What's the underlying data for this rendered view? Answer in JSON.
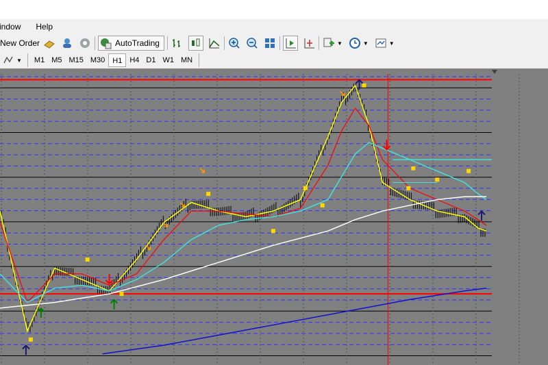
{
  "menu": {
    "items": [
      "indow",
      "Help"
    ]
  },
  "toolbar": {
    "new_order_label": "New Order",
    "autotrading_label": "AutoTrading"
  },
  "timeframes": {
    "items": [
      "M1",
      "M5",
      "M15",
      "M30",
      "H1",
      "H4",
      "D1",
      "W1",
      "MN"
    ],
    "active": "H1"
  },
  "colors": {
    "chart_bg": "#808080",
    "candles": "#000000",
    "ma_fast": "#ffff00",
    "ma_mid": "#ff0000",
    "ma_cyan": "#40e0e0",
    "ma_slow": "#ffffff",
    "ma_long": "#1010d0",
    "level_line": "#ff0000",
    "grid_solid": "#000000",
    "grid_dash": "#3030ff",
    "marker_square": "#ffd700",
    "arrow_orange": "#ff9900",
    "arrow_up_green": "#008000",
    "arrow_up_navy": "#1a1a6e",
    "arrow_down_red": "#ff0000"
  },
  "icons": [
    "chevron-down-icon",
    "new-order-icon",
    "gold-bars-icon",
    "people-icon",
    "signal-icon",
    "autotrading-icon",
    "bar-chart-icon",
    "candle-chart-icon",
    "line-chart-icon",
    "zoom-in-icon",
    "zoom-out-icon",
    "tile-windows-icon",
    "autoscroll-icon",
    "chart-shift-icon",
    "indicators-icon",
    "clock-icon",
    "templates-icon"
  ],
  "chart_data": {
    "type": "line",
    "series": [
      {
        "id": "price",
        "x": [
          0,
          40,
          80,
          120,
          160,
          200,
          240,
          280,
          320,
          360,
          400,
          440,
          480,
          500,
          520,
          540,
          560,
          600,
          640,
          680,
          700,
          712
        ],
        "y": [
          0.52,
          0.1,
          0.32,
          0.28,
          0.24,
          0.35,
          0.48,
          0.55,
          0.52,
          0.5,
          0.52,
          0.56,
          0.78,
          0.9,
          0.96,
          0.82,
          0.62,
          0.56,
          0.52,
          0.5,
          0.46,
          0.45
        ]
      },
      {
        "id": "ma_mid",
        "x": [
          0,
          40,
          80,
          120,
          160,
          200,
          240,
          280,
          320,
          360,
          400,
          440,
          480,
          500,
          520,
          540,
          560,
          600,
          640,
          680,
          700,
          712
        ],
        "y": [
          0.48,
          0.2,
          0.3,
          0.3,
          0.26,
          0.3,
          0.42,
          0.52,
          0.52,
          0.51,
          0.5,
          0.53,
          0.68,
          0.8,
          0.88,
          0.82,
          0.7,
          0.6,
          0.56,
          0.52,
          0.49,
          0.47
        ]
      },
      {
        "id": "ma_cyan",
        "x": [
          0,
          40,
          80,
          120,
          160,
          200,
          240,
          280,
          320,
          360,
          400,
          440,
          480,
          500,
          520,
          540,
          560,
          600,
          640,
          680,
          700,
          712
        ],
        "y": [
          0.3,
          0.2,
          0.25,
          0.26,
          0.24,
          0.28,
          0.34,
          0.42,
          0.47,
          0.49,
          0.5,
          0.52,
          0.56,
          0.64,
          0.72,
          0.76,
          0.74,
          0.7,
          0.66,
          0.62,
          0.58,
          0.56
        ]
      },
      {
        "id": "ma_slow",
        "x": [
          0,
          80,
          160,
          240,
          320,
          400,
          480,
          520,
          560,
          600,
          640,
          680,
          712
        ],
        "y": [
          0.18,
          0.2,
          0.23,
          0.28,
          0.34,
          0.4,
          0.45,
          0.49,
          0.52,
          0.54,
          0.56,
          0.57,
          0.57
        ]
      },
      {
        "id": "ma_long",
        "x": [
          150,
          240,
          330,
          420,
          510,
          600,
          680,
          712
        ],
        "y": [
          0.02,
          0.05,
          0.09,
          0.13,
          0.17,
          0.21,
          0.24,
          0.25
        ]
      }
    ],
    "levels": [
      0.98,
      0.23
    ],
    "vline_x": 568,
    "xlim": [
      0,
      720
    ],
    "ylim": [
      0,
      1
    ],
    "squares": [
      [
        45,
        0.07
      ],
      [
        128,
        0.35
      ],
      [
        178,
        0.23
      ],
      [
        305,
        0.58
      ],
      [
        400,
        0.45
      ],
      [
        447,
        0.6
      ],
      [
        472,
        0.54
      ],
      [
        533,
        0.96
      ],
      [
        598,
        0.6
      ],
      [
        605,
        0.67
      ],
      [
        640,
        0.63
      ],
      [
        686,
        0.66
      ]
    ],
    "arrows_orange": [
      [
        218,
        0.39
      ],
      [
        243,
        0.47
      ],
      [
        268,
        0.54
      ],
      [
        297,
        0.66
      ],
      [
        502,
        0.93
      ]
    ],
    "arrows_up_green": [
      [
        60,
        0.16
      ],
      [
        167,
        0.19
      ]
    ],
    "arrows_up_navy": [
      [
        38,
        0.03
      ],
      [
        705,
        0.5
      ],
      [
        526,
        0.96
      ]
    ],
    "arrows_down_red": [
      [
        160,
        0.28
      ],
      [
        566,
        0.75
      ]
    ]
  }
}
